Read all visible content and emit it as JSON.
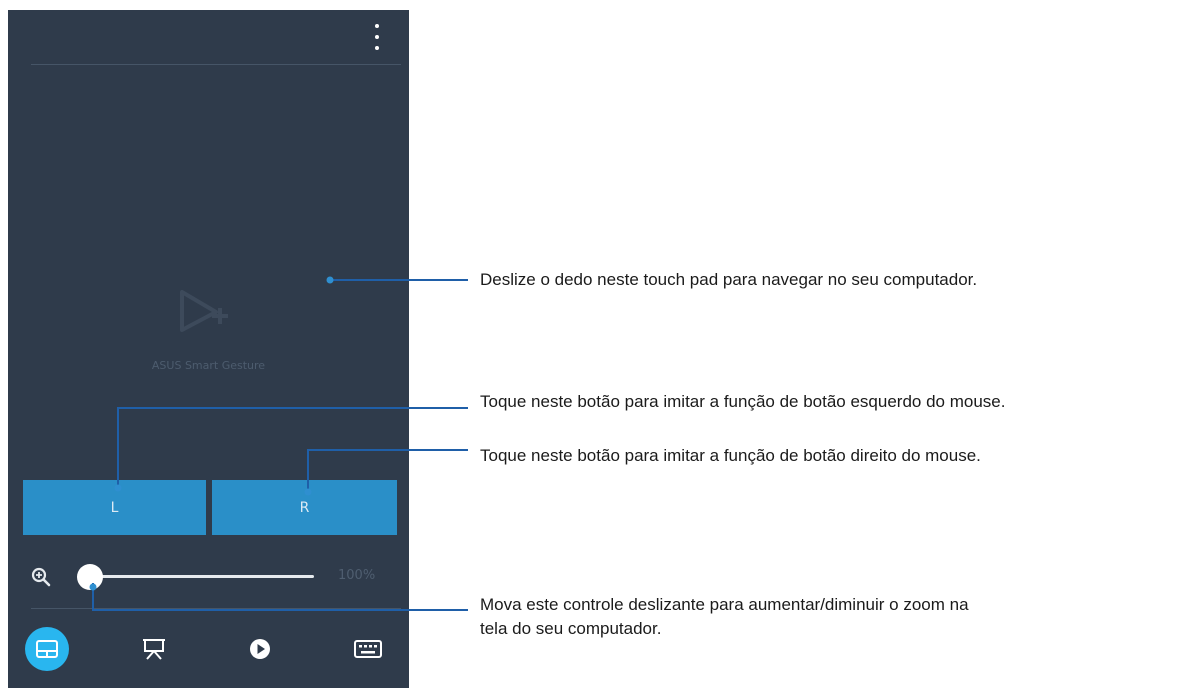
{
  "app": {
    "touchpad_caption": "ASUS Smart Gesture",
    "overflow_icon": "more-vert-icon",
    "left_button_label": "L",
    "right_button_label": "R",
    "zoom_icon": "zoom-in-icon",
    "zoom_value": "100%",
    "zoom_level_percent": 100,
    "nav": [
      {
        "icon": "touchpad-icon",
        "active": true
      },
      {
        "icon": "presentation-icon",
        "active": false
      },
      {
        "icon": "play-icon",
        "active": false
      },
      {
        "icon": "keyboard-icon",
        "active": false
      }
    ]
  },
  "callouts": {
    "touchpad": "Deslize o dedo neste touch pad para navegar no seu computador.",
    "left_button": "Toque neste botão para imitar a função de botão esquerdo do mouse.",
    "right_button": "Toque neste botão para imitar a função de botão direito do mouse.",
    "zoom_line1": "Mova este controle deslizante para aumentar/diminuir o zoom na",
    "zoom_line2": "tela do seu computador."
  },
  "colors": {
    "panel": "#2f3b4b",
    "button": "#2a8fc8",
    "active_nav": "#29b6ef",
    "callout_line": "#1f5fa8"
  }
}
